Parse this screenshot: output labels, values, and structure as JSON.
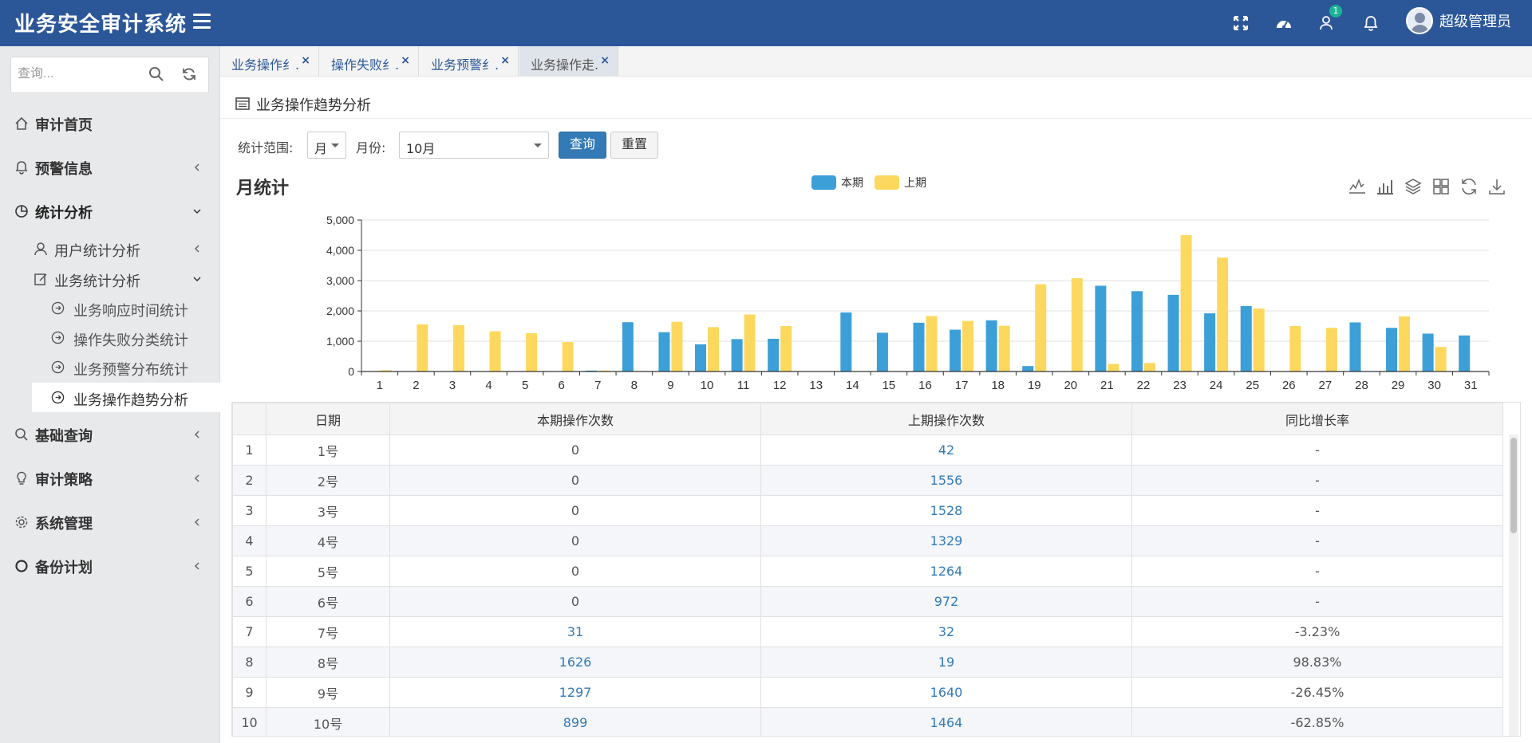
{
  "header": {
    "brand": "业务安全审计系统",
    "notification_badge": "1",
    "user_name": "超级管理员",
    "icons": [
      "fullscreen-icon",
      "dashboard-icon",
      "user-alert-icon",
      "bell-icon"
    ],
    "bar_color": "#2b5799"
  },
  "sidebar": {
    "search_placeholder": "查询...",
    "menu": [
      {
        "label": "审计首页",
        "icon": "home-icon"
      },
      {
        "label": "预警信息",
        "icon": "bell-icon"
      },
      {
        "label": "统计分析",
        "icon": "pie-chart-icon",
        "expanded": true
      },
      {
        "label": "基础查询",
        "icon": "search-icon"
      },
      {
        "label": "审计策略",
        "icon": "lightbulb-icon"
      },
      {
        "label": "系统管理",
        "icon": "gear-icon"
      },
      {
        "label": "备份计划",
        "icon": "circle-icon"
      }
    ],
    "submenu": [
      {
        "label": "用户统计分析",
        "icon": "user-icon"
      },
      {
        "label": "业务统计分析",
        "icon": "edit-icon",
        "expanded": true
      }
    ],
    "leaves": [
      {
        "label": "业务响应时间统计"
      },
      {
        "label": "操作失败分类统计"
      },
      {
        "label": "业务预警分布统计"
      },
      {
        "label": "业务操作趋势分析",
        "active": true
      }
    ]
  },
  "tabs": [
    {
      "label": "业务操作纟...",
      "close": "×"
    },
    {
      "label": "操作失败纟...",
      "close": "×"
    },
    {
      "label": "业务预警纟...",
      "close": "×"
    },
    {
      "label": "业务操作走...",
      "close": "×",
      "active": true
    }
  ],
  "panel": {
    "title": "业务操作趋势分析",
    "filters": {
      "range_label": "统计范围:",
      "range_value": "月",
      "month_label": "月份:",
      "month_value": "10月",
      "query_button": "查询",
      "reset_button": "重置"
    }
  },
  "chart_data": {
    "type": "bar",
    "title": "月统计",
    "categories": [
      "1",
      "2",
      "3",
      "4",
      "5",
      "6",
      "7",
      "8",
      "9",
      "10",
      "11",
      "12",
      "13",
      "14",
      "15",
      "16",
      "17",
      "18",
      "19",
      "20",
      "21",
      "22",
      "23",
      "24",
      "25",
      "26",
      "27",
      "28",
      "29",
      "30",
      "31"
    ],
    "series": [
      {
        "name": "本期",
        "color": "#3c9fd8",
        "values": [
          0,
          0,
          0,
          0,
          0,
          0,
          31,
          1626,
          1297,
          899,
          1070,
          1080,
          0,
          1950,
          1280,
          1610,
          1380,
          1690,
          180,
          0,
          2830,
          2650,
          2530,
          1920,
          2160,
          0,
          0,
          1620,
          1440,
          1250,
          1190
        ]
      },
      {
        "name": "上期",
        "color": "#fdd85e",
        "values": [
          42,
          1556,
          1528,
          1329,
          1264,
          972,
          32,
          19,
          1640,
          1464,
          1880,
          1500,
          0,
          0,
          0,
          1830,
          1670,
          1510,
          2880,
          3080,
          250,
          280,
          4500,
          3760,
          2080,
          1500,
          1440,
          0,
          1820,
          810,
          0
        ]
      }
    ],
    "ylim": [
      0,
      5000
    ],
    "yticks": [
      "0",
      "1,000",
      "2,000",
      "3,000",
      "4,000",
      "5,000"
    ],
    "legend_position": "top-center",
    "grid": true,
    "toolbox": [
      "line-chart-icon",
      "bar-chart-icon",
      "stack-icon",
      "tiled-icon",
      "refresh-icon",
      "download-icon"
    ]
  },
  "table": {
    "columns": [
      "",
      "日期",
      "本期操作次数",
      "上期操作次数",
      "同比增长率"
    ],
    "rows": [
      {
        "idx": "1",
        "date": "1号",
        "cur": "0",
        "prev": "42",
        "rate": "-"
      },
      {
        "idx": "2",
        "date": "2号",
        "cur": "0",
        "prev": "1556",
        "rate": "-"
      },
      {
        "idx": "3",
        "date": "3号",
        "cur": "0",
        "prev": "1528",
        "rate": "-"
      },
      {
        "idx": "4",
        "date": "4号",
        "cur": "0",
        "prev": "1329",
        "rate": "-"
      },
      {
        "idx": "5",
        "date": "5号",
        "cur": "0",
        "prev": "1264",
        "rate": "-"
      },
      {
        "idx": "6",
        "date": "6号",
        "cur": "0",
        "prev": "972",
        "rate": "-"
      },
      {
        "idx": "7",
        "date": "7号",
        "cur": "31",
        "prev": "32",
        "rate": "-3.23%"
      },
      {
        "idx": "8",
        "date": "8号",
        "cur": "1626",
        "prev": "19",
        "rate": "98.83%"
      },
      {
        "idx": "9",
        "date": "9号",
        "cur": "1297",
        "prev": "1640",
        "rate": "-26.45%"
      },
      {
        "idx": "10",
        "date": "10号",
        "cur": "899",
        "prev": "1464",
        "rate": "-62.85%"
      }
    ]
  }
}
